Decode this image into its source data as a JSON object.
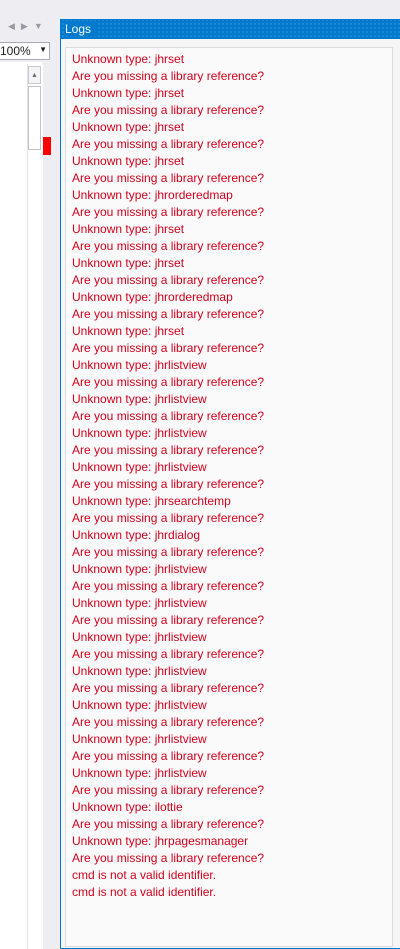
{
  "editor": {
    "zoom_value": "100%",
    "scroll_up_icon": "chevron-up-icon",
    "dropdown_icon": "chevron-down-icon"
  },
  "logs_panel": {
    "title": "Logs",
    "entries": [
      "Unknown type: jhrset",
      "Are you missing a library reference?",
      "Unknown type: jhrset",
      "Are you missing a library reference?",
      "Unknown type: jhrset",
      "Are you missing a library reference?",
      "Unknown type: jhrset",
      "Are you missing a library reference?",
      "Unknown type: jhrorderedmap",
      "Are you missing a library reference?",
      "Unknown type: jhrset",
      "Are you missing a library reference?",
      "Unknown type: jhrset",
      "Are you missing a library reference?",
      "Unknown type: jhrorderedmap",
      "Are you missing a library reference?",
      "Unknown type: jhrset",
      "Are you missing a library reference?",
      "Unknown type: jhrlistview",
      "Are you missing a library reference?",
      "Unknown type: jhrlistview",
      "Are you missing a library reference?",
      "Unknown type: jhrlistview",
      "Are you missing a library reference?",
      "Unknown type: jhrlistview",
      "Are you missing a library reference?",
      "Unknown type: jhrsearchtemp",
      "Are you missing a library reference?",
      "Unknown type: jhrdialog",
      "Are you missing a library reference?",
      "Unknown type: jhrlistview",
      "Are you missing a library reference?",
      "Unknown type: jhrlistview",
      "Are you missing a library reference?",
      "Unknown type: jhrlistview",
      "Are you missing a library reference?",
      "Unknown type: jhrlistview",
      "Are you missing a library reference?",
      "Unknown type: jhrlistview",
      "Are you missing a library reference?",
      "Unknown type: jhrlistview",
      "Are you missing a library reference?",
      "Unknown type: jhrlistview",
      "Are you missing a library reference?",
      "Unknown type: ilottie",
      "Are you missing a library reference?",
      "Unknown type: jhrpagesmanager",
      "Are you missing a library reference?",
      "cmd is not a valid identifier.",
      "cmd is not a valid identifier."
    ],
    "text_color": "#d4001c",
    "title_bar_color": "#007acc"
  }
}
